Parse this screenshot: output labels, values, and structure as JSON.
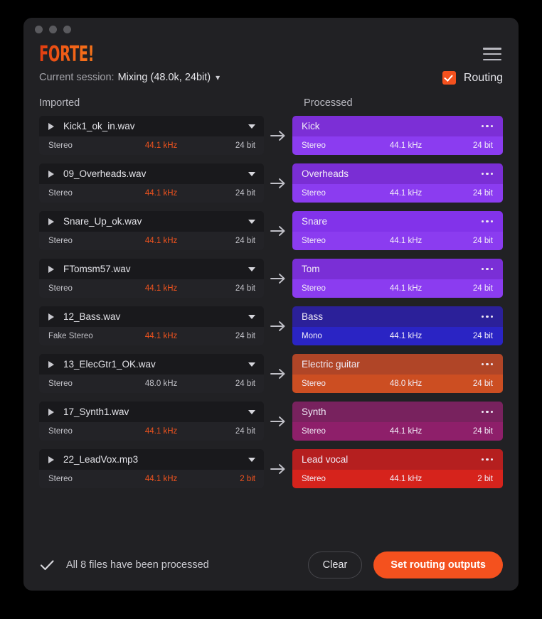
{
  "window": {
    "traffic_lights": [
      "close",
      "minimize",
      "maximize"
    ]
  },
  "header": {
    "logo": "FORTE!",
    "session_label": "Current session:",
    "session_value": "Mixing (48.0k, 24bit)",
    "session_chevron": "chevron-down-icon",
    "menu_icon": "hamburger-menu-icon",
    "routing_label": "Routing",
    "routing_checked": true,
    "accent_color": "#f4511e"
  },
  "columns": {
    "imported_title": "Imported",
    "processed_title": "Processed"
  },
  "rows": [
    {
      "imported": {
        "name": "Kick1_ok_in.wav",
        "channels": "Stereo",
        "rate": "44.1 kHz",
        "bits": "24 bit",
        "rate_warn": true,
        "bits_warn": false
      },
      "processed": {
        "name": "Kick",
        "channels": "Stereo",
        "rate": "44.1 kHz",
        "bits": "24 bit",
        "header_color": "#7c2fd6",
        "body_color": "#8b3cf0"
      }
    },
    {
      "imported": {
        "name": "09_Overheads.wav",
        "channels": "Stereo",
        "rate": "44.1 kHz",
        "bits": "24 bit",
        "rate_warn": true,
        "bits_warn": false
      },
      "processed": {
        "name": "Overheads",
        "channels": "Stereo",
        "rate": "44.1 kHz",
        "bits": "24 bit",
        "header_color": "#7a2ed4",
        "body_color": "#8b3cf0"
      }
    },
    {
      "imported": {
        "name": "Snare_Up_ok.wav",
        "channels": "Stereo",
        "rate": "44.1 kHz",
        "bits": "24 bit",
        "rate_warn": true,
        "bits_warn": false
      },
      "processed": {
        "name": "Snare",
        "channels": "Stereo",
        "rate": "44.1 kHz",
        "bits": "24 bit",
        "header_color": "#8233ea",
        "body_color": "#8b3cf0"
      }
    },
    {
      "imported": {
        "name": "FTomsm57.wav",
        "channels": "Stereo",
        "rate": "44.1 kHz",
        "bits": "24 bit",
        "rate_warn": true,
        "bits_warn": false
      },
      "processed": {
        "name": "Tom",
        "channels": "Stereo",
        "rate": "44.1 kHz",
        "bits": "24 bit",
        "header_color": "#7a2fd6",
        "body_color": "#8b3cf0"
      }
    },
    {
      "imported": {
        "name": "12_Bass.wav",
        "channels": "Fake Stereo",
        "rate": "44.1 kHz",
        "bits": "24 bit",
        "rate_warn": true,
        "bits_warn": false
      },
      "processed": {
        "name": "Bass",
        "channels": "Mono",
        "rate": "44.1 kHz",
        "bits": "24 bit",
        "header_color": "#2b2099",
        "body_color": "#2a24c4"
      }
    },
    {
      "imported": {
        "name": "13_ElecGtr1_OK.wav",
        "channels": "Stereo",
        "rate": "48.0 kHz",
        "bits": "24 bit",
        "rate_warn": false,
        "bits_warn": false
      },
      "processed": {
        "name": "Electric guitar",
        "channels": "Stereo",
        "rate": "48.0 kHz",
        "bits": "24 bit",
        "header_color": "#b04527",
        "body_color": "#cc4e22"
      }
    },
    {
      "imported": {
        "name": "17_Synth1.wav",
        "channels": "Stereo",
        "rate": "44.1 kHz",
        "bits": "24 bit",
        "rate_warn": true,
        "bits_warn": false
      },
      "processed": {
        "name": "Synth",
        "channels": "Stereo",
        "rate": "44.1 kHz",
        "bits": "24 bit",
        "header_color": "#78225e",
        "body_color": "#8e1f6a"
      }
    },
    {
      "imported": {
        "name": "22_LeadVox.mp3",
        "channels": "Stereo",
        "rate": "44.1 kHz",
        "bits": "2 bit",
        "rate_warn": true,
        "bits_warn": true
      },
      "processed": {
        "name": "Lead vocal",
        "channels": "Stereo",
        "rate": "44.1 kHz",
        "bits": "2 bit",
        "header_color": "#b51f1f",
        "body_color": "#d6231c"
      }
    }
  ],
  "footer": {
    "check_icon": "checkmark-icon",
    "status": "All 8 files have been processed",
    "clear_label": "Clear",
    "routing_label": "Set routing outputs"
  }
}
